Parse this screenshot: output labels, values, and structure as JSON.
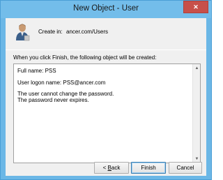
{
  "window": {
    "title": "New Object - User",
    "close_glyph": "✕"
  },
  "header": {
    "icon": "user-icon",
    "create_in_label": "Create in:",
    "create_in_path": "ancer.com/Users"
  },
  "intro_text": "When you click Finish, the following object will be created:",
  "summary": {
    "lines": [
      "Full name: PSS",
      "User logon name: PSS@ancer.com",
      "The user cannot change the password.",
      "The password never expires."
    ]
  },
  "buttons": {
    "back_prefix": "< ",
    "back_mnemonic": "B",
    "back_rest": "ack",
    "finish": "Finish",
    "cancel": "Cancel"
  },
  "colors": {
    "titlebar": "#73bdea",
    "close_button": "#c7504a",
    "dialog_bg": "#f0f0f0"
  }
}
